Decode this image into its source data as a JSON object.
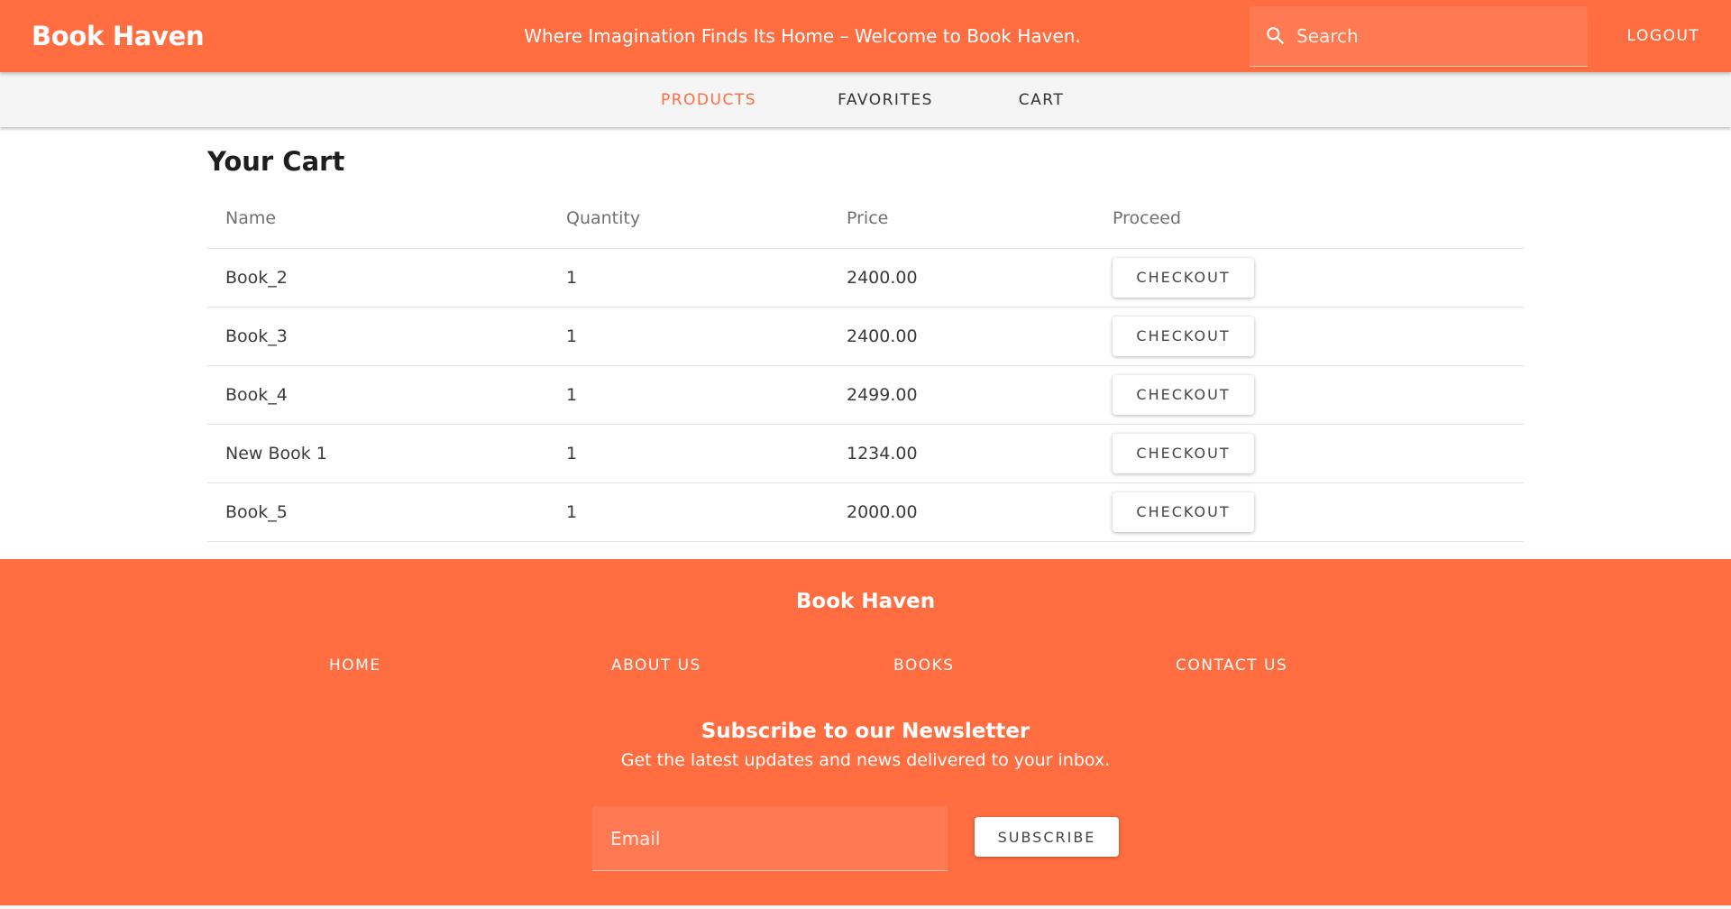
{
  "header": {
    "brand": "Book Haven",
    "tagline": "Where Imagination Finds Its Home – Welcome to Book Haven.",
    "search_placeholder": "Search",
    "search_icon": "search-icon",
    "logout_label": "LOGOUT"
  },
  "tabs": [
    {
      "label": "PRODUCTS",
      "active": true
    },
    {
      "label": "FAVORITES",
      "active": false
    },
    {
      "label": "CART",
      "active": false
    }
  ],
  "cart": {
    "title": "Your Cart",
    "columns": [
      "Name",
      "Quantity",
      "Price",
      "Proceed"
    ],
    "checkout_label": "CHECKOUT",
    "rows": [
      {
        "name": "Book_2",
        "quantity": "1",
        "price": "2400.00"
      },
      {
        "name": "Book_3",
        "quantity": "1",
        "price": "2400.00"
      },
      {
        "name": "Book_4",
        "quantity": "1",
        "price": "2499.00"
      },
      {
        "name": "New Book 1",
        "quantity": "1",
        "price": "1234.00"
      },
      {
        "name": "Book_5",
        "quantity": "1",
        "price": "2000.00"
      }
    ]
  },
  "footer": {
    "brand": "Book Haven",
    "links": [
      "HOME",
      "ABOUT US",
      "BOOKS",
      "CONTACT US"
    ],
    "newsletter_title": "Subscribe to our Newsletter",
    "newsletter_subtitle": "Get the latest updates and news delivered to your inbox.",
    "email_placeholder": "Email",
    "subscribe_label": "SUBSCRIBE"
  },
  "colors": {
    "accent": "#ff6d40",
    "field_bg": "#ff7a52",
    "tab_bar_bg": "#f5f5f5"
  }
}
